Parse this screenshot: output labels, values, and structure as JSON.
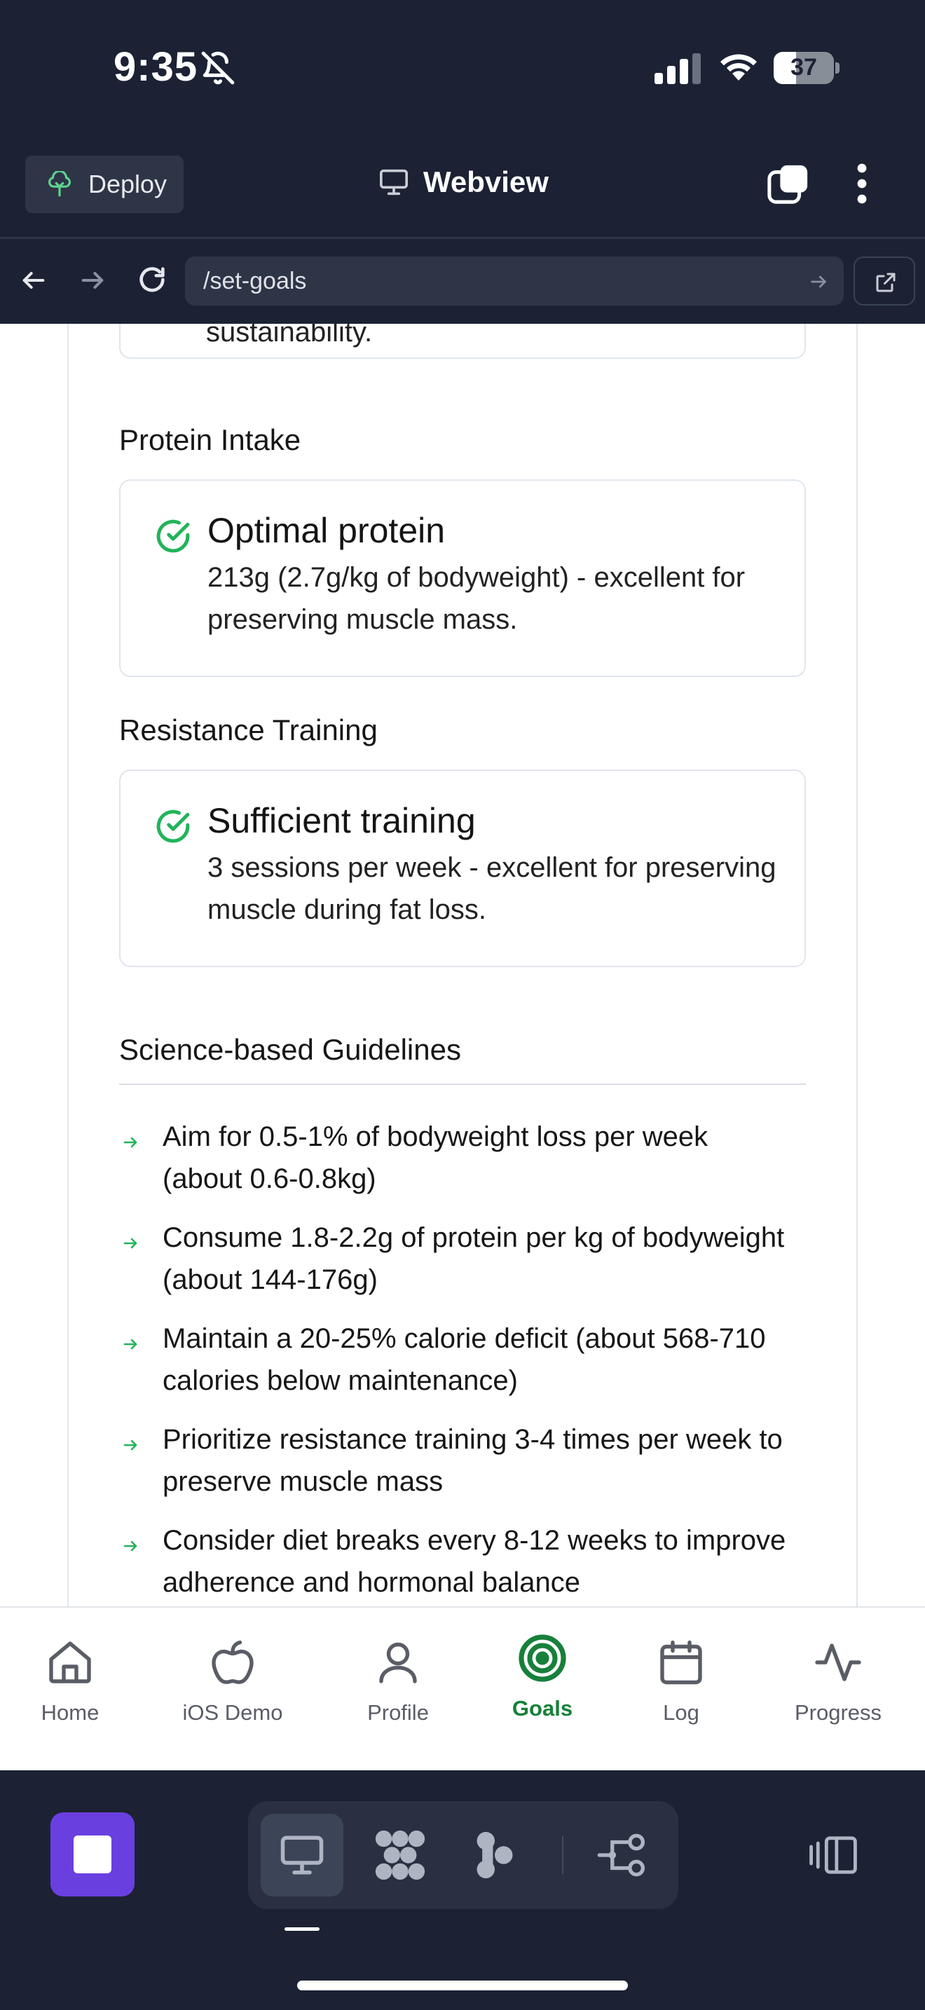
{
  "status_bar": {
    "time": "9:35",
    "battery": "37",
    "battery_level": 0.37
  },
  "toolbar": {
    "deploy_label": "Deploy",
    "title": "Webview"
  },
  "url_bar": {
    "path": "/set-goals"
  },
  "content": {
    "previous_text": "sustainability.",
    "protein": {
      "section_label": "Protein Intake",
      "title": "Optimal protein",
      "description": "213g (2.7g/kg of bodyweight) - excellent for preserving muscle mass."
    },
    "training": {
      "section_label": "Resistance Training",
      "title": "Sufficient training",
      "description": "3 sessions per week - excellent for preserving muscle during fat loss."
    },
    "guidelines": {
      "title": "Science-based Guidelines",
      "items": [
        "Aim for 0.5-1% of bodyweight loss per week (about 0.6-0.8kg)",
        "Consume 1.8-2.2g of protein per kg of bodyweight (about 144-176g)",
        "Maintain a 20-25% calorie deficit (about 568-710 calories below maintenance)",
        "Prioritize resistance training 3-4 times per week to preserve muscle mass",
        "Consider diet breaks every 8-12 weeks to improve adherence and hormonal balance"
      ]
    }
  },
  "bottom_nav": {
    "items": [
      {
        "label": "Home",
        "icon": "home-icon"
      },
      {
        "label": "iOS Demo",
        "icon": "apple-icon"
      },
      {
        "label": "Profile",
        "icon": "user-icon"
      },
      {
        "label": "Goals",
        "icon": "target-icon",
        "active": true
      },
      {
        "label": "Log",
        "icon": "calendar-icon"
      },
      {
        "label": "Progress",
        "icon": "activity-icon"
      }
    ]
  },
  "colors": {
    "accent_green": "#17803a",
    "check_green": "#22b35a",
    "dark_bg": "#1c2234",
    "stop_purple": "#6a3fe0"
  }
}
